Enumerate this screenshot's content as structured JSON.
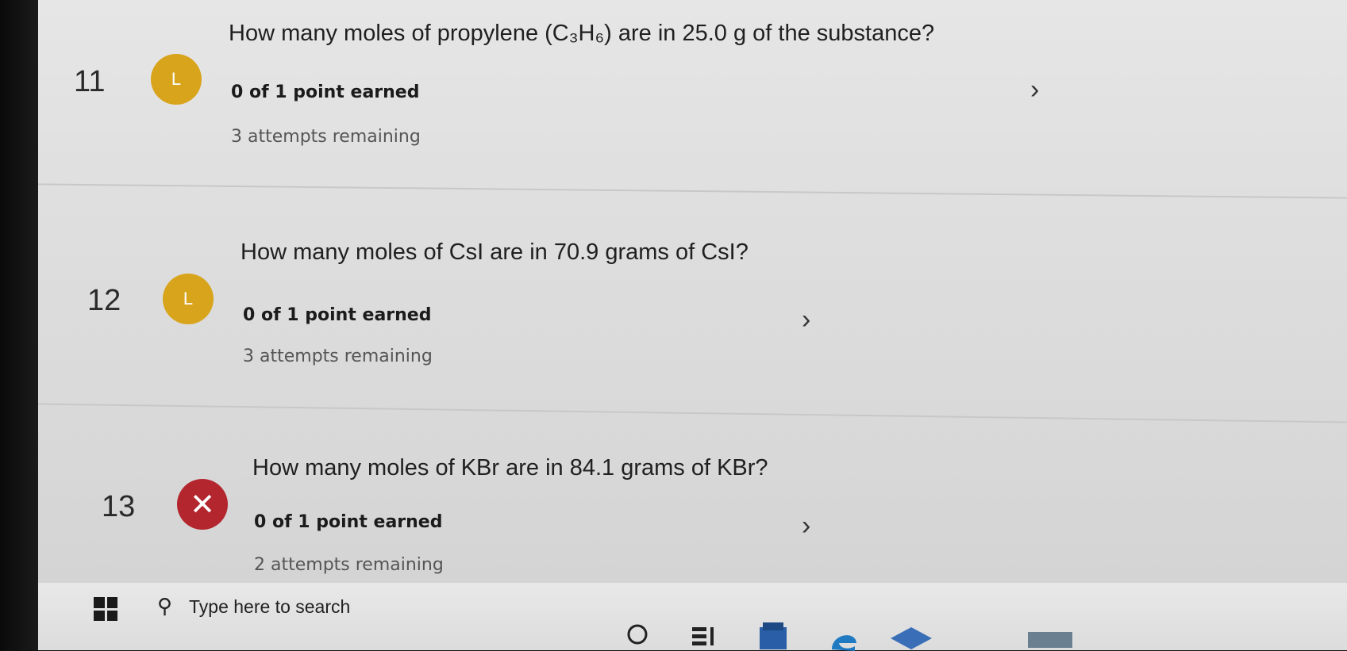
{
  "questions": [
    {
      "number": "11",
      "text": "How many moles of propylene (C₃H₆) are in 25.0 g of the substance?",
      "status_letter": "L",
      "points": "0 of 1 point earned",
      "attempts": "3 attempts remaining",
      "status": "late"
    },
    {
      "number": "12",
      "text": "How many moles of  CsI are in 70.9 grams of CsI?",
      "status_letter": "L",
      "points": "0 of 1 point earned",
      "attempts": "3 attempts remaining",
      "status": "late"
    },
    {
      "number": "13",
      "text": "How many moles of  KBr are in 84.1 grams of KBr?",
      "status_letter": "✕",
      "points": "0 of 1 point earned",
      "attempts": "2 attempts remaining",
      "status": "incorrect"
    }
  ],
  "chevron": "›",
  "taskbar": {
    "search_placeholder": "Type here to search"
  },
  "icons": {
    "late": "clock-late-icon",
    "incorrect": "x-icon",
    "chevron": "chevron-right-icon",
    "search": "search-icon",
    "windows": "windows-logo-icon"
  },
  "colors": {
    "late": "#d8a41c",
    "incorrect": "#b3262e"
  }
}
